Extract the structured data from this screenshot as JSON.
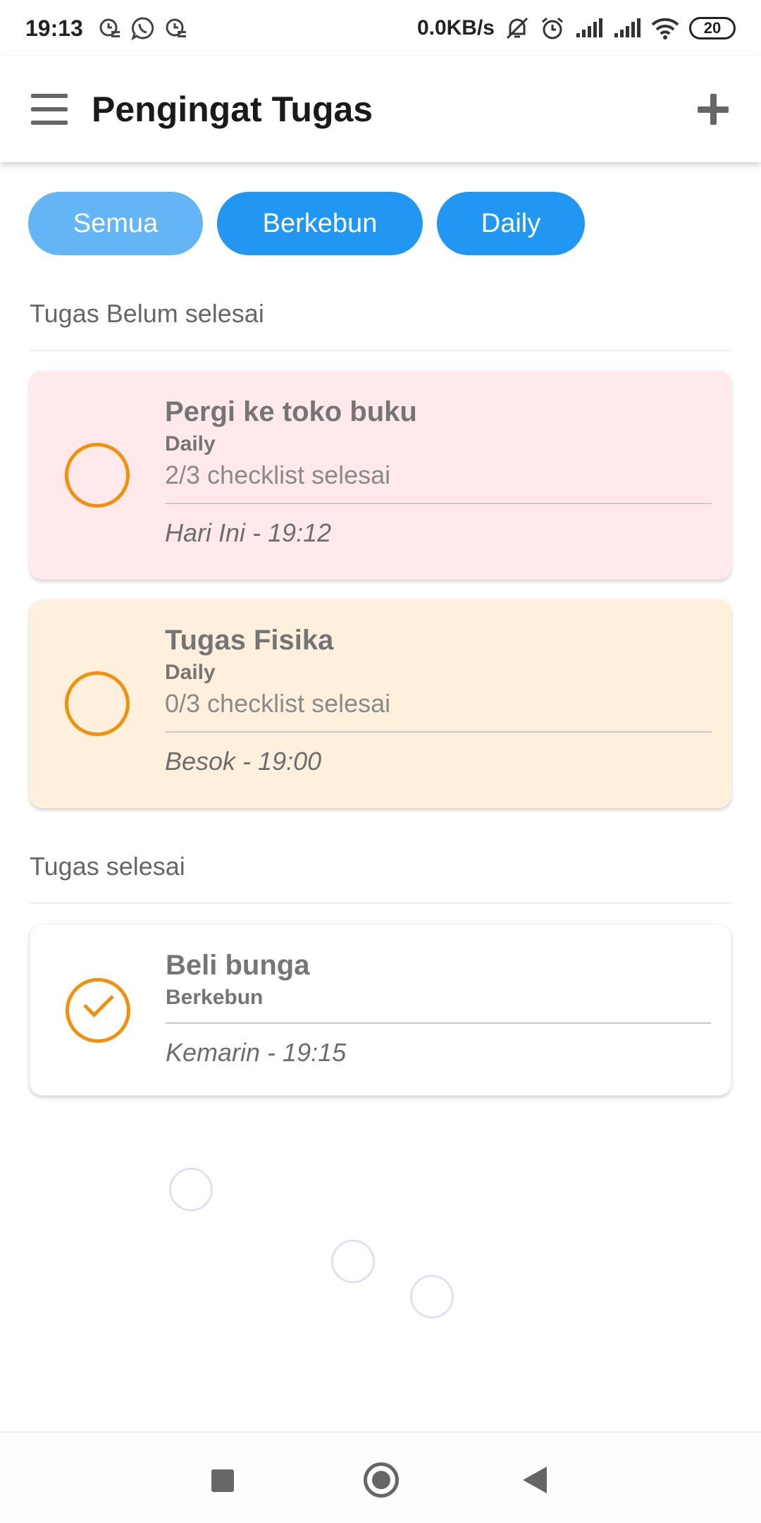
{
  "status_bar": {
    "time": "19:13",
    "network_speed": "0.0KB/s",
    "battery": "20",
    "icons": [
      "clock-notification-icon",
      "whatsapp-icon",
      "clock-notification-icon",
      "mute-icon",
      "alarm-icon",
      "signal-icon",
      "signal-icon",
      "wifi-icon",
      "battery-icon"
    ]
  },
  "app_bar": {
    "title": "Pengingat Tugas",
    "menu_icon": "menu-icon",
    "add_icon": "plus-icon"
  },
  "filters": [
    {
      "label": "Semua",
      "color": "#64b5f6"
    },
    {
      "label": "Berkebun",
      "color": "#2196f3"
    },
    {
      "label": "Daily",
      "color": "#2196f3"
    }
  ],
  "sections": {
    "pending_title": "Tugas Belum selesai",
    "done_title": "Tugas selesai"
  },
  "pending_tasks": [
    {
      "title": "Pergi ke toko buku",
      "category": "Daily",
      "checklist": "2/3 checklist selesai",
      "due": "Hari Ini - 19:12",
      "bg": "#ffe9eb"
    },
    {
      "title": "Tugas Fisika",
      "category": "Daily",
      "checklist": "0/3 checklist selesai",
      "due": "Besok - 19:00",
      "bg": "#fff0de"
    }
  ],
  "done_tasks": [
    {
      "title": "Beli bunga",
      "category": "Berkebun",
      "due": "Kemarin - 19:15",
      "bg": "#ffffff"
    }
  ],
  "nav_bar": {
    "icons": [
      "recents-icon",
      "home-icon",
      "back-icon"
    ]
  },
  "colors": {
    "accent": "#2196f3",
    "check_orange": "#f2900e"
  }
}
